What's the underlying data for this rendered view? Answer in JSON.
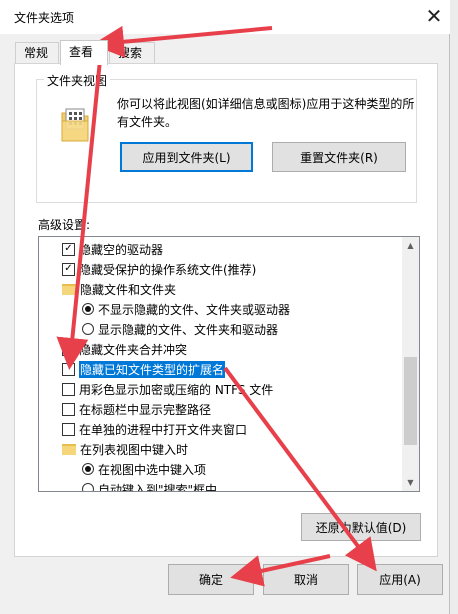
{
  "window": {
    "title": "文件夹选项"
  },
  "tabs": [
    {
      "label": "常规"
    },
    {
      "label": "查看"
    },
    {
      "label": "搜索"
    }
  ],
  "folder_view": {
    "label": "文件夹视图",
    "description": "你可以将此视图(如详细信息或图标)应用于这种类型的所有文件夹。",
    "apply_button": "应用到文件夹(L)",
    "reset_button": "重置文件夹(R)"
  },
  "advanced": {
    "label": "高级设置:",
    "items": [
      {
        "kind": "checkbox",
        "checked": true,
        "indent": 0,
        "label": "隐藏空的驱动器"
      },
      {
        "kind": "checkbox",
        "checked": true,
        "indent": 0,
        "label": "隐藏受保护的操作系统文件(推荐)"
      },
      {
        "kind": "folder",
        "indent": 0,
        "label": "隐藏文件和文件夹"
      },
      {
        "kind": "radio",
        "checked": true,
        "indent": 1,
        "label": "不显示隐藏的文件、文件夹或驱动器"
      },
      {
        "kind": "radio",
        "checked": false,
        "indent": 1,
        "label": "显示隐藏的文件、文件夹和驱动器"
      },
      {
        "kind": "checkbox",
        "checked": true,
        "indent": 0,
        "label": "隐藏文件夹合并冲突"
      },
      {
        "kind": "checkbox",
        "checked": false,
        "indent": 0,
        "label": "隐藏已知文件类型的扩展名",
        "selected": true
      },
      {
        "kind": "checkbox",
        "checked": false,
        "indent": 0,
        "label": "用彩色显示加密或压缩的 NTFS 文件"
      },
      {
        "kind": "checkbox",
        "checked": false,
        "indent": 0,
        "label": "在标题栏中显示完整路径"
      },
      {
        "kind": "checkbox",
        "checked": false,
        "indent": 0,
        "label": "在单独的进程中打开文件夹窗口"
      },
      {
        "kind": "folder",
        "indent": 0,
        "label": "在列表视图中键入时"
      },
      {
        "kind": "radio",
        "checked": true,
        "indent": 1,
        "label": "在视图中选中键入项"
      },
      {
        "kind": "radio",
        "checked": false,
        "indent": 1,
        "label": "自动键入到\"搜索\"框中"
      }
    ],
    "restore_button": "还原为默认值(D)"
  },
  "footer": {
    "ok": "确定",
    "cancel": "取消",
    "apply": "应用(A)"
  },
  "icons": {
    "close": "close-icon",
    "check": "✓",
    "scroll_up": "▲",
    "scroll_down": "▼"
  },
  "colors": {
    "accent": "#0078d7",
    "arrow": "#e8404a"
  }
}
